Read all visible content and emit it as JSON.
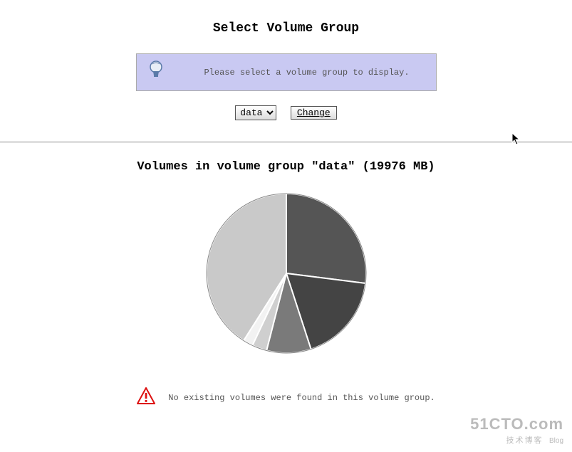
{
  "header": {
    "title": "Select Volume Group",
    "info_message": "Please select a volume group to display."
  },
  "controls": {
    "select_options": [
      "data"
    ],
    "selected": "data",
    "change_label": "Change"
  },
  "volumes": {
    "title": "Volumes in volume group \"data\" (19976 MB)",
    "status_message": "No existing volumes were found in this volume group."
  },
  "watermark": {
    "line1": "51CTO.com",
    "line2": "技术博客",
    "line3": "Blog"
  },
  "chart_data": {
    "type": "pie",
    "title": "Volumes in volume group \"data\" (19976 MB)",
    "total_mb": 19976,
    "slices": [
      {
        "label": "segment-1",
        "approx_percent": 27,
        "color": "#555555"
      },
      {
        "label": "segment-2",
        "approx_percent": 18,
        "color": "#444444"
      },
      {
        "label": "segment-3",
        "approx_percent": 9,
        "color": "#7a7a7a"
      },
      {
        "label": "segment-4",
        "approx_percent": 3,
        "color": "#cfcfcf"
      },
      {
        "label": "segment-5",
        "approx_percent": 2,
        "color": "#f2f2f2"
      },
      {
        "label": "segment-6",
        "approx_percent": 41,
        "color": "#c9c9c9"
      }
    ]
  }
}
